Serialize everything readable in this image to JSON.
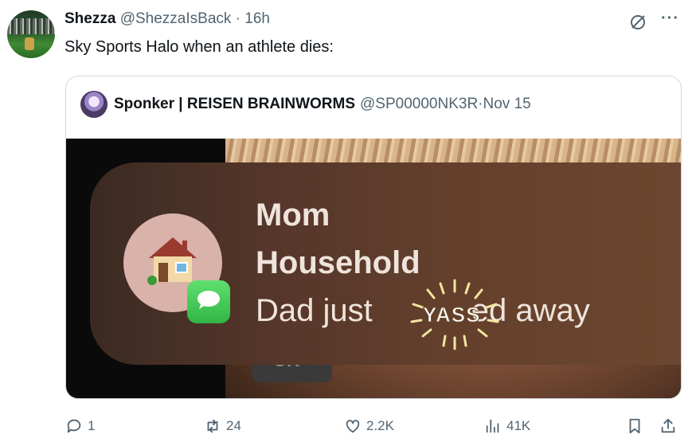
{
  "tweet": {
    "author_name": "Shezza",
    "handle": "@ShezzaIsBack",
    "separator": " · ",
    "time": "16h",
    "text": "Sky Sports Halo when an athlete dies:"
  },
  "quoted": {
    "author_name": "Sponker | REISEN BRAINWORMS",
    "handle": "@SP00000NK3R",
    "separator": " · ",
    "date": "Nov 15",
    "notification": {
      "title": "Mom",
      "subtitle": "Household",
      "body": "Dad just",
      "body_end": "ed away",
      "stamp": "YASS",
      "partial_underlay_text": "OK"
    }
  },
  "actions": {
    "replies": "1",
    "reposts": "24",
    "likes": "2.2K",
    "views": "41K"
  },
  "colors": {
    "muted_text": "#536471",
    "notification_bg": "#5a3a2a",
    "messages_green": "#34c759"
  },
  "icons": [
    "grok-icon",
    "more-icon",
    "reply-icon",
    "repost-icon",
    "like-icon",
    "views-icon",
    "bookmark-icon",
    "share-icon",
    "house-icon",
    "messages-icon"
  ]
}
